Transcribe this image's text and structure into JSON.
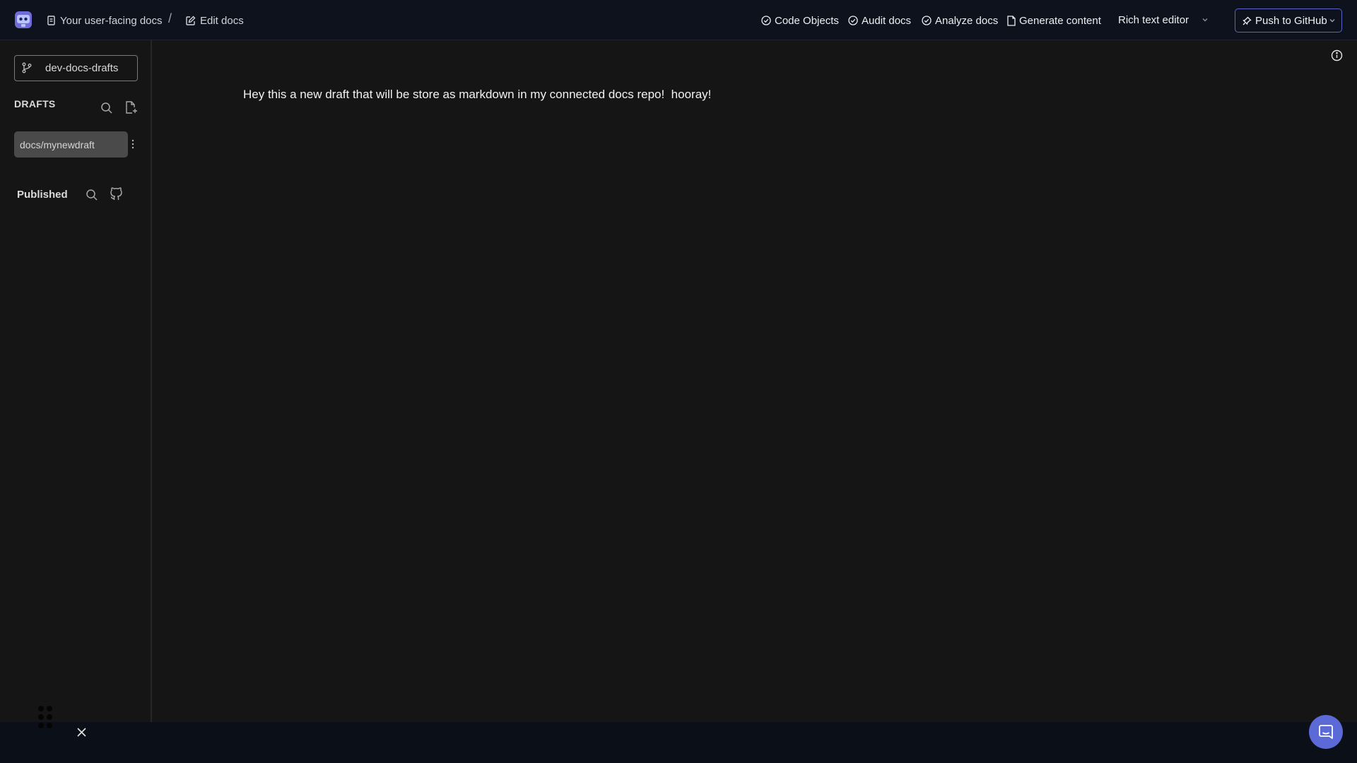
{
  "header": {
    "logo_icon": "robot-logo-icon",
    "breadcrumb": [
      {
        "label": "Your user-facing docs",
        "icon": "document-icon"
      },
      {
        "label": "Edit docs",
        "icon": "edit-icon"
      }
    ],
    "separator": "/",
    "nav": [
      {
        "label": "Code Objects",
        "icon": "check-circle-icon"
      },
      {
        "label": "Audit docs",
        "icon": "check-circle-icon"
      },
      {
        "label": "Analyze docs",
        "icon": "check-circle-icon"
      },
      {
        "label": "Generate content",
        "icon": "file-icon"
      }
    ],
    "editor_mode": "Rich text editor",
    "push_button": "Push to GitHub",
    "accent": "#5b63c7"
  },
  "sidebar": {
    "branch": "dev-docs-drafts",
    "drafts_title": "DRAFTS",
    "drafts": [
      {
        "label": "docs/mynewdraft"
      }
    ],
    "published_title": "Published"
  },
  "main": {
    "content": "Hey this a new draft that will be store as markdown in my connected docs repo!  hooray!"
  },
  "footer": {
    "chat_color": "#5b6ad6"
  }
}
